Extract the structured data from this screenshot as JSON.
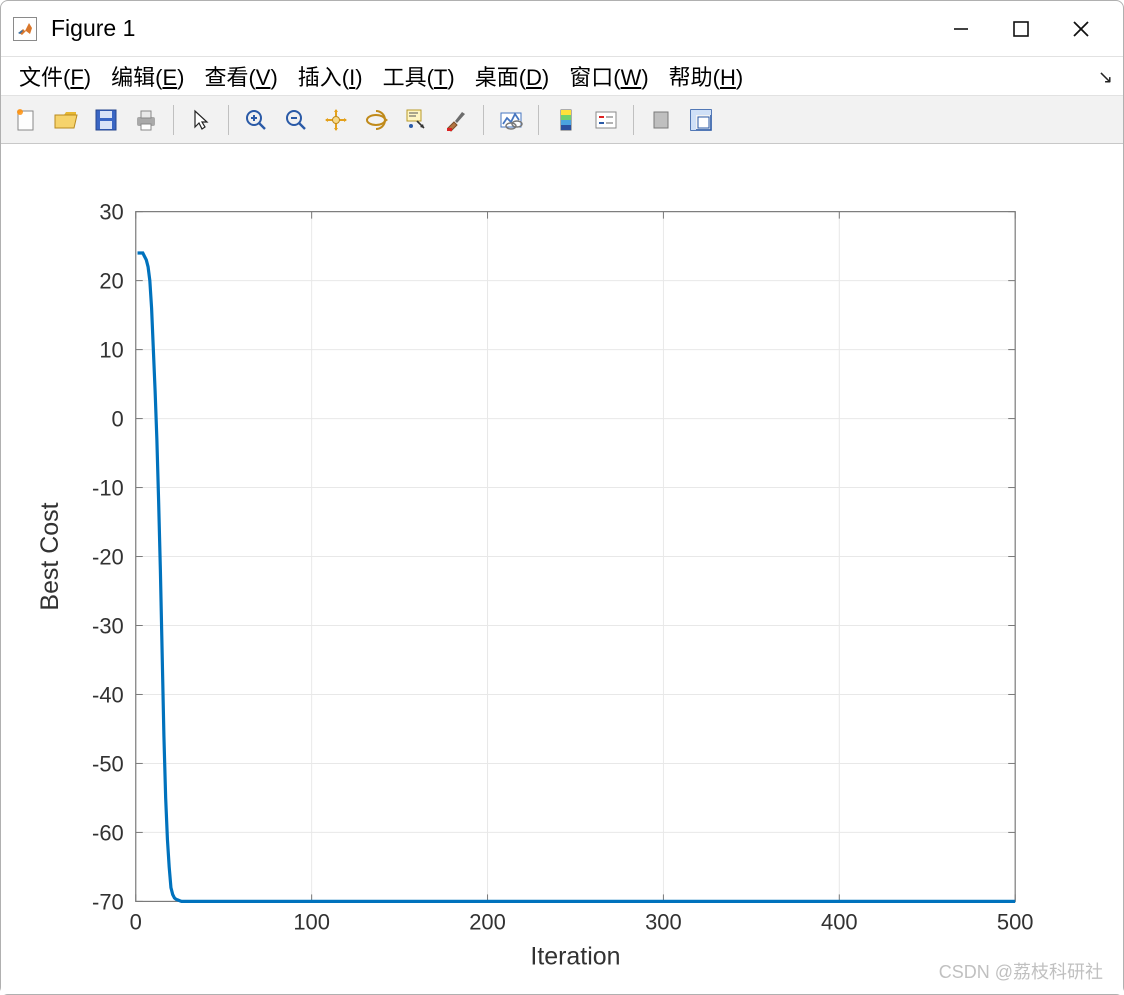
{
  "window": {
    "title": "Figure 1",
    "app_icon_name": "matlab-icon"
  },
  "menubar": {
    "items": [
      {
        "label": "文件",
        "mnemonic": "F"
      },
      {
        "label": "编辑",
        "mnemonic": "E"
      },
      {
        "label": "查看",
        "mnemonic": "V"
      },
      {
        "label": "插入",
        "mnemonic": "I"
      },
      {
        "label": "工具",
        "mnemonic": "T"
      },
      {
        "label": "桌面",
        "mnemonic": "D"
      },
      {
        "label": "窗口",
        "mnemonic": "W"
      },
      {
        "label": "帮助",
        "mnemonic": "H"
      }
    ]
  },
  "toolbar": {
    "icons": [
      "new-figure-icon",
      "open-icon",
      "save-icon",
      "print-icon",
      "sep",
      "pointer-icon",
      "sep",
      "zoom-in-icon",
      "zoom-out-icon",
      "pan-icon",
      "rotate3d-icon",
      "data-cursor-icon",
      "brush-icon",
      "sep",
      "link-plot-icon",
      "sep",
      "colorbar-icon",
      "legend-icon",
      "sep",
      "hide-plot-tools-icon",
      "show-plot-tools-icon"
    ]
  },
  "chart_data": {
    "type": "line",
    "xlabel": "Iteration",
    "ylabel": "Best Cost",
    "xlim": [
      0,
      500
    ],
    "ylim": [
      -70,
      30
    ],
    "xticks": [
      0,
      100,
      200,
      300,
      400,
      500
    ],
    "yticks": [
      -70,
      -60,
      -50,
      -40,
      -30,
      -20,
      -10,
      0,
      10,
      20,
      30
    ],
    "grid": true,
    "series": [
      {
        "name": "Best Cost",
        "color": "#0072bd",
        "x": [
          1,
          2,
          3,
          4,
          5,
          6,
          7,
          8,
          9,
          10,
          11,
          12,
          13,
          14,
          15,
          16,
          17,
          18,
          19,
          20,
          21,
          22,
          23,
          24,
          25,
          26,
          27,
          28,
          30,
          35,
          40,
          50,
          60,
          80,
          100,
          150,
          200,
          250,
          300,
          350,
          400,
          450,
          500
        ],
        "y": [
          24,
          24,
          24,
          24,
          23.5,
          23,
          22,
          20,
          16,
          10,
          4,
          -3,
          -12,
          -22,
          -34,
          -46,
          -55,
          -61,
          -65,
          -68,
          -69,
          -69.5,
          -69.7,
          -69.8,
          -69.9,
          -70,
          -70,
          -70,
          -70,
          -70,
          -70,
          -70,
          -70,
          -70,
          -70,
          -70,
          -70,
          -70,
          -70,
          -70,
          -70,
          -70,
          -70
        ]
      }
    ]
  },
  "watermark": "CSDN @荔枝科研社"
}
